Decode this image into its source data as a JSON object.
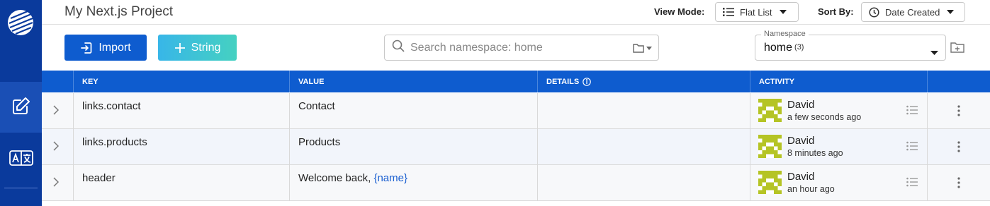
{
  "project_title": "My Next.js Project",
  "view_mode": {
    "label": "View Mode:",
    "value": "Flat List",
    "icon": "list-icon"
  },
  "sort_by": {
    "label": "Sort By:",
    "value": "Date Created",
    "icon": "clock-icon"
  },
  "actions": {
    "import_label": "Import",
    "string_label": "String"
  },
  "search": {
    "placeholder": "Search namespace: home",
    "value": ""
  },
  "namespace": {
    "label": "Namespace",
    "value": "home",
    "count": "(3)"
  },
  "table": {
    "headers": {
      "key": "KEY",
      "value": "VALUE",
      "details": "DETAILS",
      "activity": "ACTIVITY"
    },
    "rows": [
      {
        "key": "links.contact",
        "value_text": "Contact",
        "value_param": "",
        "user": "David",
        "time": "a few seconds ago"
      },
      {
        "key": "links.products",
        "value_text": "Products",
        "value_param": "",
        "user": "David",
        "time": "8 minutes ago"
      },
      {
        "key": "header",
        "value_text": "Welcome back, ",
        "value_param": "{name}",
        "user": "David",
        "time": "an hour ago"
      }
    ]
  },
  "colors": {
    "sidebar": "#0a3a9c",
    "primary": "#0e5ccf",
    "avatar": "#b5c425"
  }
}
